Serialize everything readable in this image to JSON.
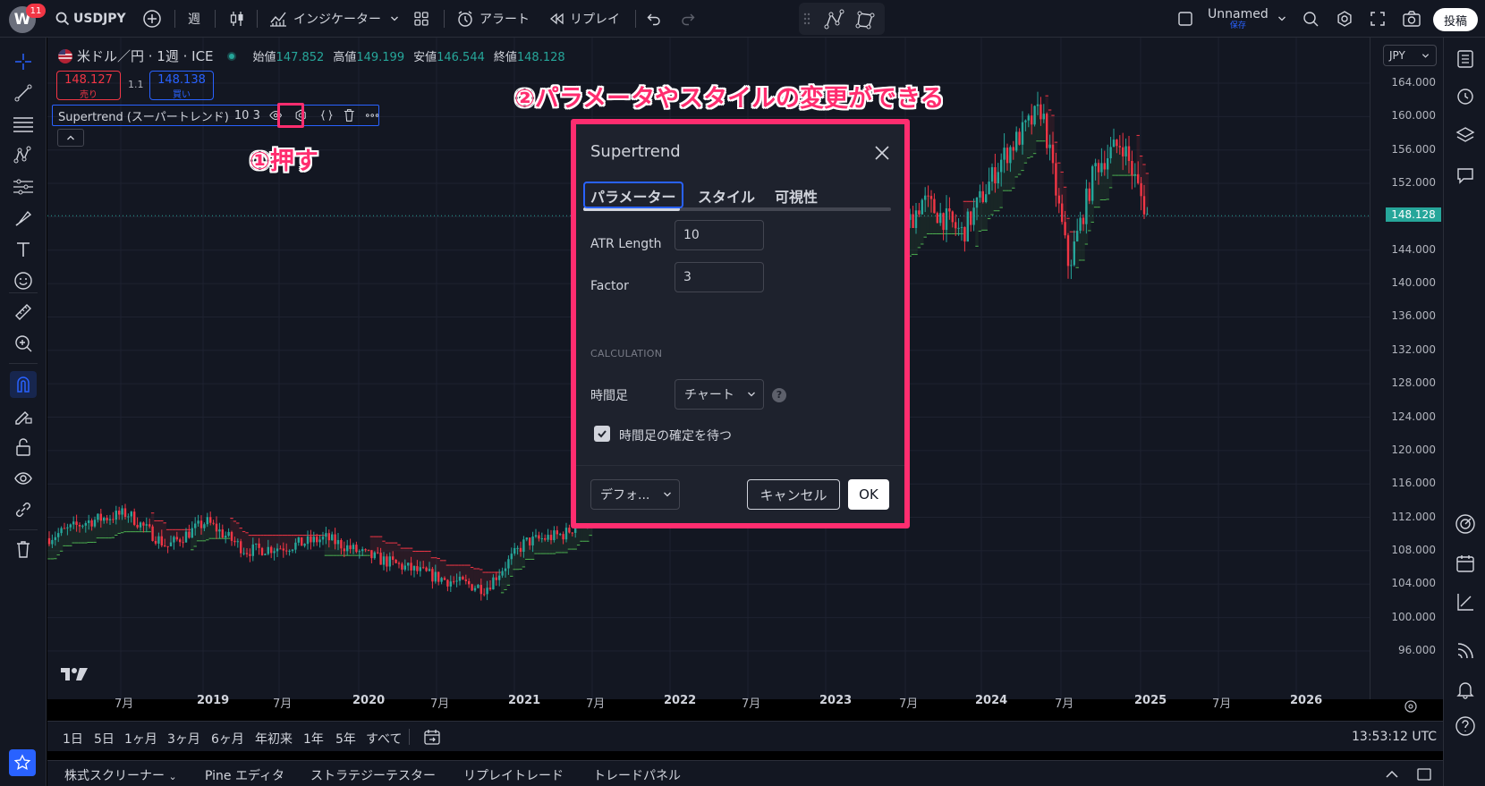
{
  "topbar": {
    "notification_count": "11",
    "logo_letter": "W",
    "symbol": "USDJPY",
    "interval": "週",
    "indicators_label": "インジケーター",
    "alert_label": "アラート",
    "replay_label": "リプレイ",
    "layout_name": "Unnamed",
    "layout_status": "保存",
    "post_label": "投稿"
  },
  "legend": {
    "symbol_title": "米ドル／円 · 1週 · ICE",
    "open_label": "始値",
    "open": "147.852",
    "high_label": "高値",
    "high": "149.199",
    "low_label": "安値",
    "low": "146.544",
    "close_label": "終値",
    "close": "148.128",
    "sell_price": "148.127",
    "sell_label": "売り",
    "spread": "1.1",
    "buy_price": "148.138",
    "buy_label": "買い",
    "indicator_name": "Supertrend (スーパートレンド)",
    "indicator_params": "10 3"
  },
  "annotations": {
    "step1": "①押す",
    "step2": "②パラメータやスタイルの変更ができる"
  },
  "dialog": {
    "title": "Supertrend",
    "tabs": [
      {
        "label": "パラメーター",
        "active": true
      },
      {
        "label": "スタイル",
        "active": false
      },
      {
        "label": "可視性",
        "active": false
      }
    ],
    "atr_label": "ATR Length",
    "atr_value": "10",
    "factor_label": "Factor",
    "factor_value": "3",
    "section_label": "CALCULATION",
    "timeframe_label": "時間足",
    "timeframe_value": "チャート",
    "help_icon": "?",
    "wait_confirm_label": "時間足の確定を待つ",
    "wait_confirm_checked": true,
    "defaults_label": "デフォ...",
    "cancel_label": "キャンセル",
    "ok_label": "OK"
  },
  "price_axis": {
    "currency": "JPY",
    "current_price": "148.128",
    "labels": [
      "164.000",
      "160.000",
      "156.000",
      "152.000",
      "148.000",
      "144.000",
      "140.000",
      "136.000",
      "132.000",
      "128.000",
      "124.000",
      "120.000",
      "116.000",
      "112.000",
      "108.000",
      "104.000",
      "100.000",
      "96.000"
    ]
  },
  "time_axis": {
    "labels": [
      "7月",
      "2019",
      "7月",
      "2020",
      "7月",
      "2021",
      "7月",
      "2022",
      "7月",
      "2023",
      "7月",
      "2024",
      "7月",
      "2025",
      "7月",
      "2026"
    ]
  },
  "range_bar": {
    "ranges": [
      "1日",
      "5日",
      "1ヶ月",
      "3ヶ月",
      "6ヶ月",
      "年初来",
      "1年",
      "5年",
      "すべて"
    ],
    "clock": "13:53:12 UTC"
  },
  "bottom_panel": {
    "tabs": [
      "株式スクリーナー",
      "Pine エディタ",
      "ストラテジーテスター",
      "リプレイトレード",
      "トレードパネル"
    ]
  },
  "colors": {
    "background": "#131722",
    "up": "#26a69a",
    "down": "#f23645",
    "accent": "#2962ff",
    "annotation": "#ff2d6f",
    "supertrend_up": "#4caf50",
    "supertrend_down": "#f23645"
  },
  "chart_data": {
    "type": "candlestick",
    "symbol": "USDJPY",
    "interval": "1W",
    "ylim": [
      96,
      166
    ],
    "x_range": [
      "2018-04",
      "2026-03"
    ],
    "close_path": [
      {
        "t": "2018-04",
        "v": 109.5
      },
      {
        "t": "2018-07",
        "v": 111.5
      },
      {
        "t": "2018-10",
        "v": 112.5
      },
      {
        "t": "2019-01",
        "v": 108.5
      },
      {
        "t": "2019-04",
        "v": 111.5
      },
      {
        "t": "2019-07",
        "v": 108.0
      },
      {
        "t": "2019-10",
        "v": 108.5
      },
      {
        "t": "2020-01",
        "v": 109.5
      },
      {
        "t": "2020-04",
        "v": 107.5
      },
      {
        "t": "2020-07",
        "v": 106.0
      },
      {
        "t": "2020-10",
        "v": 104.5
      },
      {
        "t": "2021-01",
        "v": 103.5
      },
      {
        "t": "2021-04",
        "v": 109.0
      },
      {
        "t": "2021-07",
        "v": 110.0
      },
      {
        "t": "2021-10",
        "v": 113.5
      },
      {
        "t": "2022-01",
        "v": 115.0
      },
      {
        "t": "2022-04",
        "v": 130.0
      },
      {
        "t": "2022-07",
        "v": 135.0
      },
      {
        "t": "2022-10",
        "v": 149.0
      },
      {
        "t": "2023-01",
        "v": 130.0
      },
      {
        "t": "2023-04",
        "v": 134.0
      },
      {
        "t": "2023-07",
        "v": 142.0
      },
      {
        "t": "2023-10",
        "v": 150.0
      },
      {
        "t": "2024-01",
        "v": 146.0
      },
      {
        "t": "2024-04",
        "v": 155.0
      },
      {
        "t": "2024-07",
        "v": 161.0
      },
      {
        "t": "2024-09",
        "v": 142.0
      },
      {
        "t": "2024-11",
        "v": 154.0
      },
      {
        "t": "2025-01",
        "v": 157.0
      },
      {
        "t": "2025-03",
        "v": 148.1
      }
    ]
  }
}
